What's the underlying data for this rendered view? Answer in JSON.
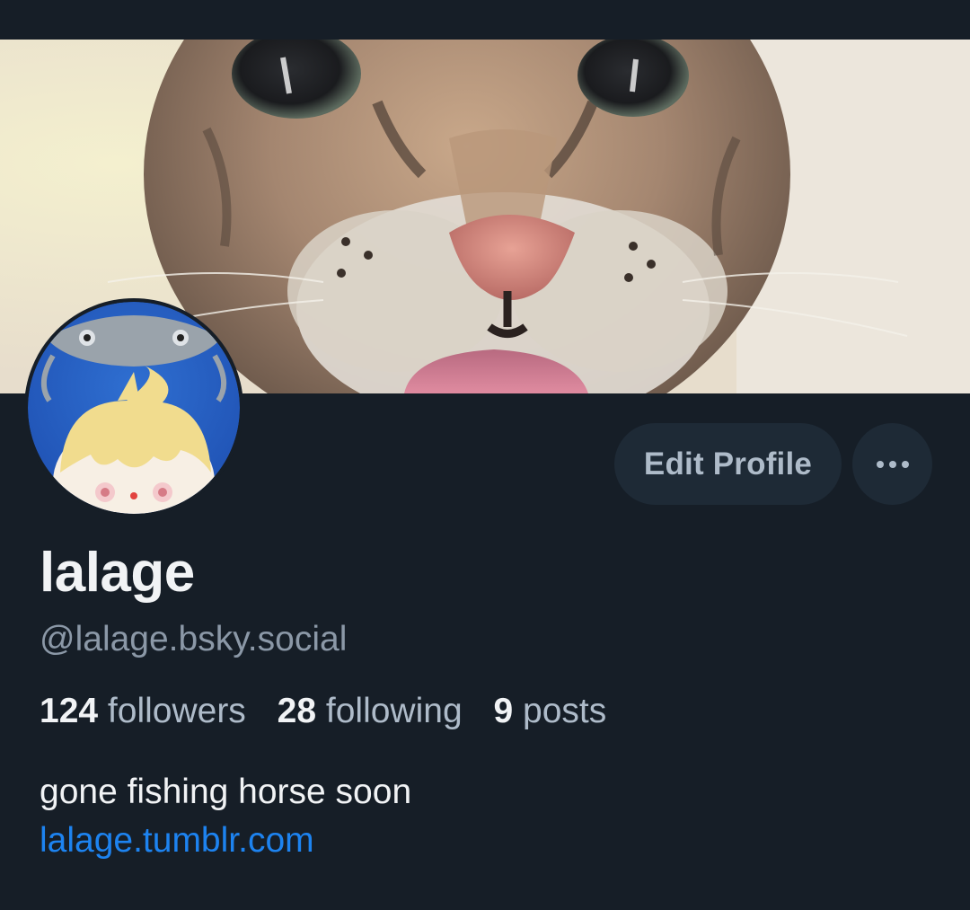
{
  "profile": {
    "display_name": "lalage",
    "handle": "@lalage.bsky.social",
    "bio": "gone fishing horse soon",
    "link": "lalage.tumblr.com"
  },
  "stats": {
    "followers_count": "124",
    "followers_label": "followers",
    "following_count": "28",
    "following_label": "following",
    "posts_count": "9",
    "posts_label": "posts"
  },
  "actions": {
    "edit_profile_label": "Edit Profile",
    "more_icon": "ellipsis-icon"
  },
  "images": {
    "banner": "cat-closeup-banner",
    "avatar": "anime-character-with-fish-avatar"
  },
  "colors": {
    "background": "#161e27",
    "button_bg": "#1e2a36",
    "link": "#1d83f0",
    "muted_text": "#8b98a7"
  }
}
